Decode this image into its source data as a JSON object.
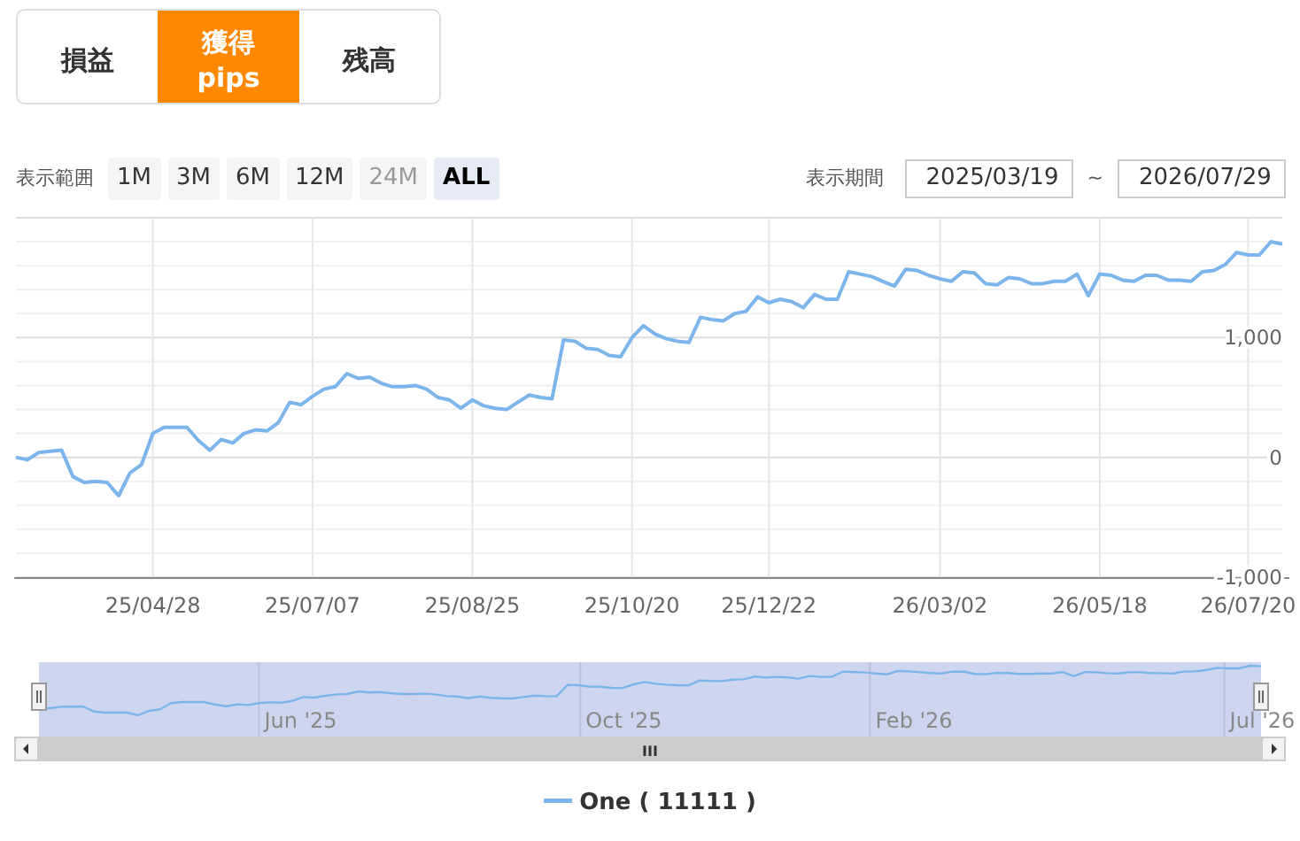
{
  "tabs": [
    {
      "label": "損益",
      "selected": false
    },
    {
      "label": "獲得\npips",
      "selected": true
    },
    {
      "label": "残高",
      "selected": false
    }
  ],
  "range": {
    "label": "表示範囲",
    "buttons": [
      {
        "label": "1M",
        "selected": false,
        "disabled": false
      },
      {
        "label": "3M",
        "selected": false,
        "disabled": false
      },
      {
        "label": "6M",
        "selected": false,
        "disabled": false
      },
      {
        "label": "12M",
        "selected": false,
        "disabled": false
      },
      {
        "label": "24M",
        "selected": false,
        "disabled": true
      },
      {
        "label": "ALL",
        "selected": true,
        "disabled": false
      }
    ]
  },
  "period": {
    "label": "表示期間",
    "from": "2025/03/19",
    "separator": "~",
    "to": "2026/07/29"
  },
  "chart_data": {
    "type": "line",
    "categories": [
      null,
      null,
      null,
      null,
      null,
      null,
      null,
      null,
      null,
      null,
      null,
      null,
      "25/04/28",
      null,
      null,
      null,
      null,
      null,
      null,
      null,
      null,
      null,
      null,
      null,
      null,
      null,
      "25/07/07",
      null,
      null,
      null,
      null,
      null,
      null,
      null,
      null,
      null,
      null,
      null,
      null,
      null,
      "25/08/25",
      null,
      null,
      null,
      null,
      null,
      null,
      null,
      null,
      null,
      null,
      null,
      null,
      null,
      "25/10/20",
      null,
      null,
      null,
      null,
      null,
      null,
      null,
      null,
      null,
      null,
      null,
      "25/12/22",
      null,
      null,
      null,
      null,
      null,
      null,
      null,
      null,
      null,
      null,
      null,
      null,
      null,
      null,
      "26/03/02",
      null,
      null,
      null,
      null,
      null,
      null,
      null,
      null,
      null,
      null,
      null,
      null,
      null,
      "26/05/18",
      null,
      null,
      null,
      null,
      null,
      null,
      null,
      null,
      null,
      null,
      null,
      null,
      "26/07/20",
      null,
      null,
      null
    ],
    "series": [
      {
        "name": "One",
        "color": "#7cb5ec",
        "values": [
          0,
          -20,
          40,
          50,
          60,
          -160,
          -210,
          -200,
          -210,
          -320,
          -130,
          -60,
          200,
          250,
          250,
          250,
          140,
          60,
          150,
          120,
          200,
          230,
          220,
          290,
          460,
          440,
          510,
          570,
          590,
          700,
          660,
          670,
          620,
          590,
          590,
          600,
          570,
          500,
          480,
          410,
          480,
          430,
          410,
          400,
          460,
          520,
          500,
          490,
          980,
          970,
          910,
          900,
          850,
          840,
          1000,
          1100,
          1030,
          990,
          970,
          960,
          1170,
          1150,
          1140,
          1200,
          1220,
          1340,
          1290,
          1320,
          1300,
          1250,
          1360,
          1320,
          1320,
          1550,
          1530,
          1510,
          1470,
          1430,
          1570,
          1560,
          1520,
          1490,
          1470,
          1550,
          1540,
          1450,
          1440,
          1500,
          1490,
          1450,
          1450,
          1470,
          1470,
          1530,
          1350,
          1530,
          1520,
          1480,
          1470,
          1520,
          1520,
          1480,
          1480,
          1470,
          1550,
          1560,
          1610,
          1710,
          1690,
          1690,
          1800,
          1780
        ]
      }
    ],
    "ylim": [
      -1000,
      2000
    ],
    "grid": true,
    "yticks": [
      {
        "value": -1000,
        "label": "-1,000"
      },
      {
        "value": 0,
        "label": "0"
      },
      {
        "value": 1000,
        "label": "1,000"
      }
    ]
  },
  "navigator": {
    "labels": [
      "Jun '25",
      "Oct '25",
      "Feb '26",
      "Jul '26"
    ],
    "scrollbar_grip": "III"
  },
  "legend": {
    "count": "( 11111 )"
  }
}
